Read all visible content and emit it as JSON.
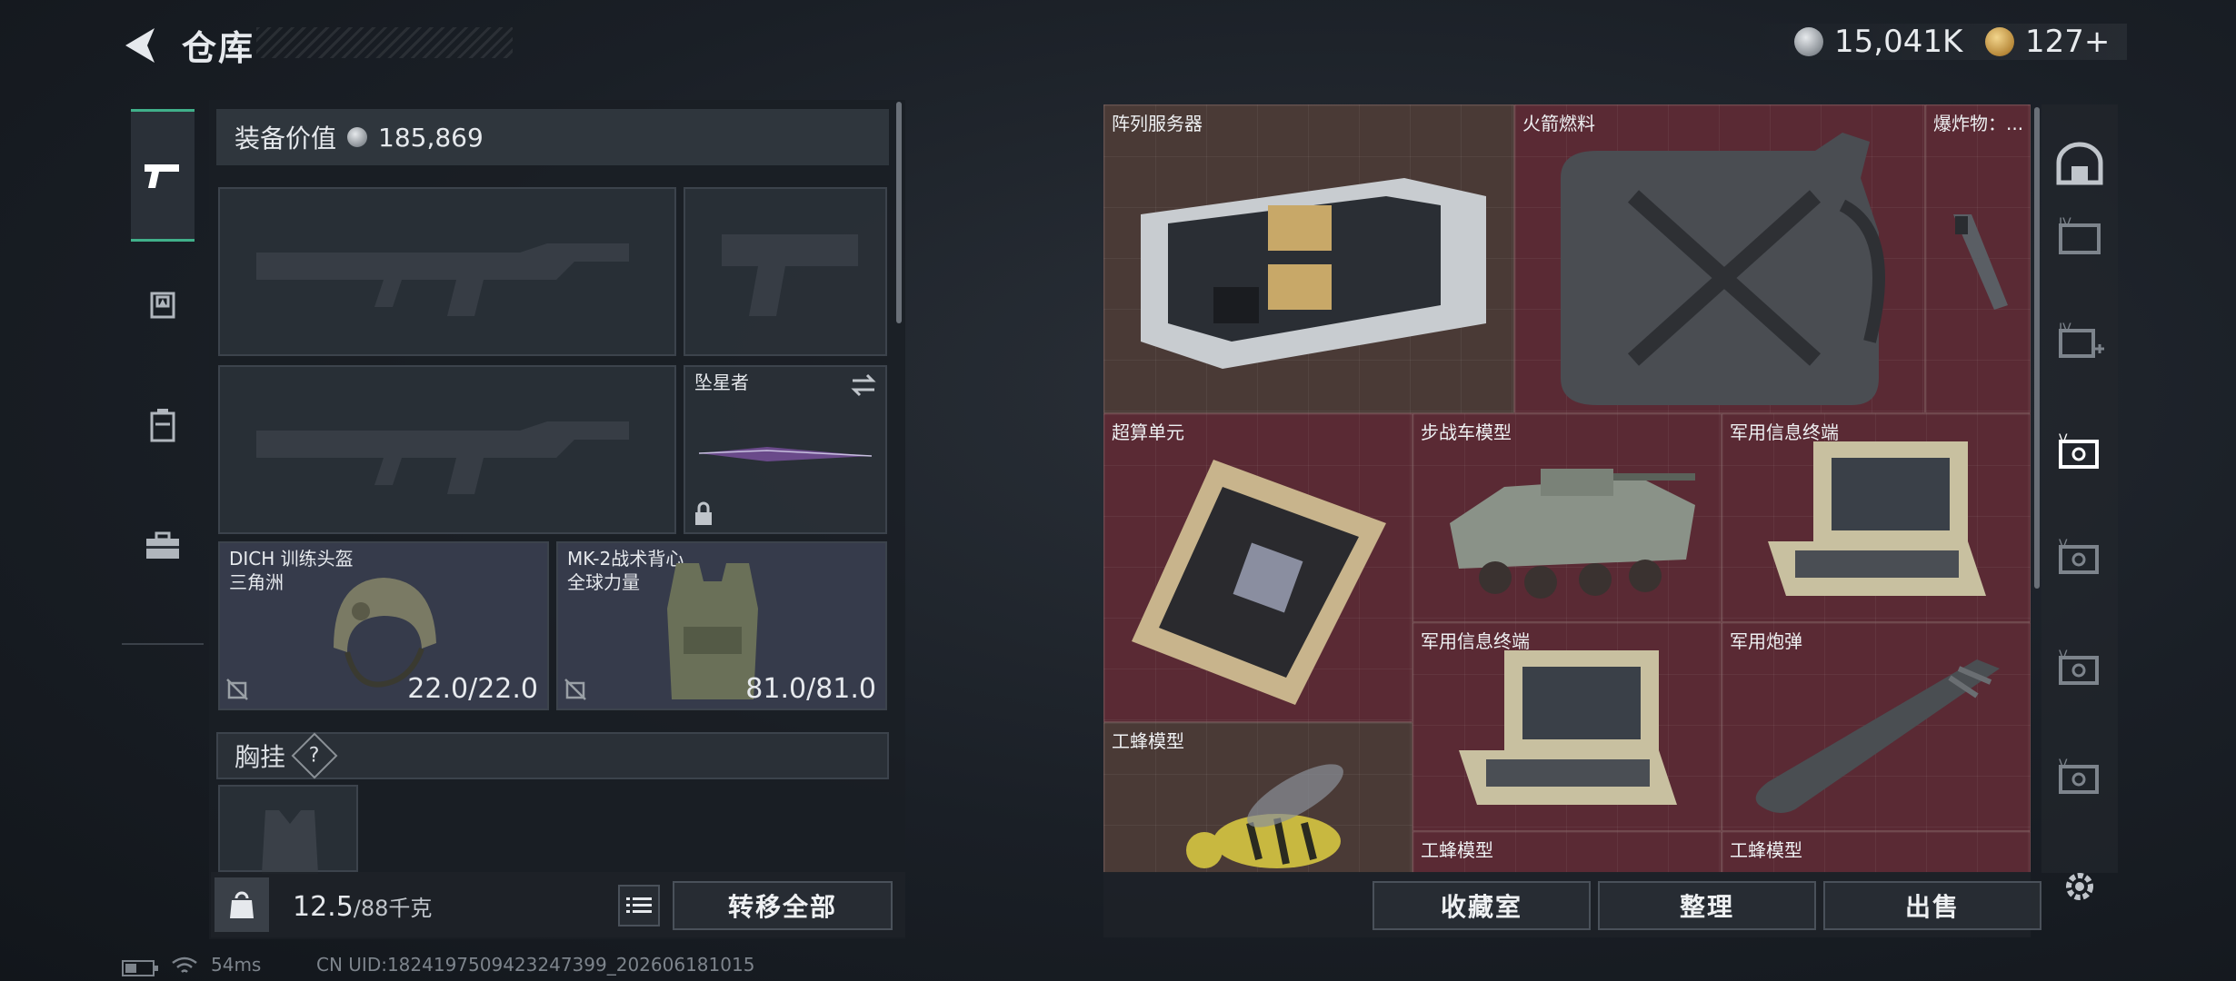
{
  "header": {
    "title": "仓库",
    "currency_silver": "15,041K",
    "currency_gold": "127+"
  },
  "equipment": {
    "value_label": "装备价值",
    "value": "185,869",
    "melee_name": "坠星者",
    "helmet": {
      "name": "DICH 训练头盔",
      "sub": "三角洲",
      "durability": "22.0/22.0"
    },
    "vest": {
      "name": "MK-2战术背心",
      "sub": "全球力量",
      "durability": "81.0/81.0"
    },
    "chest_rig_label": "胸挂",
    "help_glyph": "?"
  },
  "bottom_left": {
    "weight": "12.5",
    "weight_max": "/88千克",
    "transfer_all": "转移全部"
  },
  "grid": {
    "items": [
      {
        "label": "阵列服务器"
      },
      {
        "label": "火箭燃料"
      },
      {
        "label": "爆炸物：..."
      },
      {
        "label": "超算单元"
      },
      {
        "label": "步战车模型"
      },
      {
        "label": "军用信息终端"
      },
      {
        "label": "军用信息终端"
      },
      {
        "label": "军用炮弹"
      },
      {
        "label": "工蜂模型"
      },
      {
        "label": "工蜂模型"
      },
      {
        "label": "工蜂模型"
      }
    ]
  },
  "bottom_right": {
    "collection": "收藏室",
    "organize": "整理",
    "sell": "出售"
  },
  "status_bar": {
    "ping": "54ms",
    "uid": "CN UID:1824197509423247399_202606181015"
  }
}
